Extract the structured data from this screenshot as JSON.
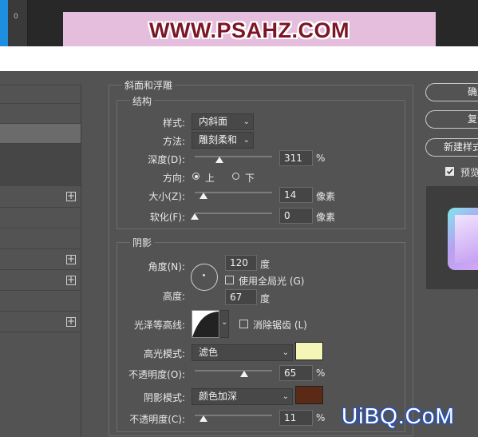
{
  "header": {
    "ruler_tick": "0",
    "banner_text": "WWW.PSAHZ.COM"
  },
  "left_panel": {
    "rows": [
      "",
      "",
      "",
      "",
      "",
      "",
      "",
      "",
      "",
      "",
      "",
      ""
    ]
  },
  "bevel": {
    "section_title": "斜面和浮雕",
    "structure_title": "结构",
    "style_label": "样式:",
    "style_value": "内斜面",
    "technique_label": "方法:",
    "technique_value": "雕刻柔和",
    "depth_label": "深度(D):",
    "depth_value": "311",
    "depth_unit": "%",
    "depth_level_pct": 30,
    "direction_label": "方向:",
    "direction_up": "上",
    "direction_down": "下",
    "size_label": "大小(Z):",
    "size_value": "14",
    "size_unit": "像素",
    "soften_label": "软化(F):",
    "soften_value": "0",
    "soften_unit": "像素"
  },
  "shading": {
    "title": "阴影",
    "angle_label": "角度(N):",
    "angle_value": "120",
    "angle_unit": "度",
    "global_light_label": "使用全局光 (G)",
    "altitude_label": "高度:",
    "altitude_value": "67",
    "altitude_unit": "度",
    "gloss_label": "光泽等高线:",
    "antialias_label": "消除锯齿 (L)",
    "highlight_mode_label": "高光模式:",
    "highlight_mode_value": "滤色",
    "highlight_color": "#f5f5b8",
    "highlight_opacity_label": "不透明度(O):",
    "highlight_opacity_value": "65",
    "highlight_opacity_unit": "%",
    "shadow_mode_label": "阴影模式:",
    "shadow_mode_value": "颜色加深",
    "shadow_color": "#5a2a17",
    "shadow_opacity_label": "不透明度(C):",
    "shadow_opacity_value": "11",
    "shadow_opacity_unit": "%"
  },
  "buttons": {
    "ok": "确定",
    "reset": "复位",
    "new_style": "新建样式",
    "preview_label": "预览"
  },
  "watermark": "UiBQ.CoM"
}
